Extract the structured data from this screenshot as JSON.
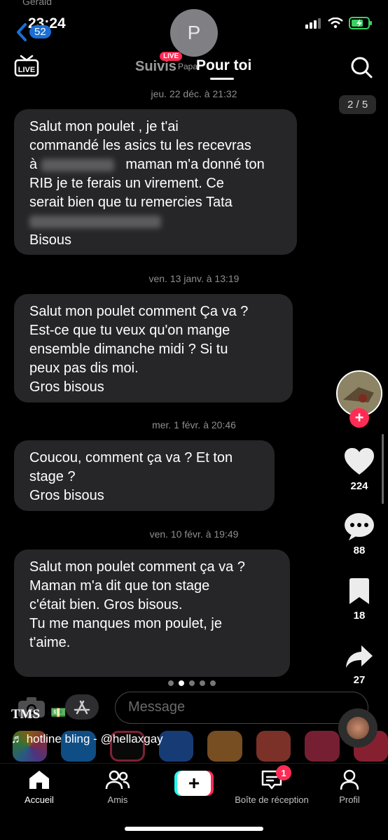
{
  "status": {
    "carrier": "Gérald",
    "time": "23:24",
    "back_count": "52"
  },
  "contact": {
    "initial": "P"
  },
  "header": {
    "tab_following": "Suivis",
    "live_badge": "LIVE",
    "live_user": "Papa",
    "tab_for_you": "Pour toi"
  },
  "photo_counter": "2 / 5",
  "messages": [
    {
      "timestamp": "jeu. 22 déc. à 21:32",
      "lines": [
        "Salut mon poulet  , je t'ai",
        "commandé les asics tu les recevras",
        "à",
        "maman m'a donné ton",
        "RIB je te ferais un virement. Ce",
        "serait bien que tu remercies Tata",
        "Bisous"
      ]
    },
    {
      "timestamp": "ven. 13 janv. à 13:19",
      "lines": [
        "Salut mon poulet comment Ça va ?",
        "Est-ce que tu veux qu'on mange",
        "ensemble dimanche midi ? Si tu",
        "peux pas dis moi.",
        "Gros bisous"
      ]
    },
    {
      "timestamp": "mer. 1 févr. à 20:46",
      "lines": [
        "Coucou, comment ça va ? Et ton",
        "stage ?",
        "Gros bisous"
      ]
    },
    {
      "timestamp": "ven. 10 févr. à 19:49",
      "lines": [
        "Salut mon poulet comment ça va ?",
        "Maman m'a dit que ton stage",
        "c'était bien. Gros bisous.",
        "Tu me manques mon poulet, je",
        "t'aime."
      ]
    }
  ],
  "rail": {
    "likes": "224",
    "comments": "88",
    "saves": "18",
    "shares": "27"
  },
  "carousel": {
    "total": 5,
    "active": 2
  },
  "input": {
    "placeholder": "Message"
  },
  "caption": {
    "user": "TMS",
    "emoji": "💵",
    "music": "♬ hotline bling - @hellaxgay"
  },
  "nav": {
    "home": "Accueil",
    "friends": "Amis",
    "inbox": "Boîte de réception",
    "inbox_badge": "1",
    "profile": "Profil"
  },
  "colors": {
    "accent": "#fe2c55",
    "bubble": "#262628",
    "timestamp": "#8e8e93"
  }
}
